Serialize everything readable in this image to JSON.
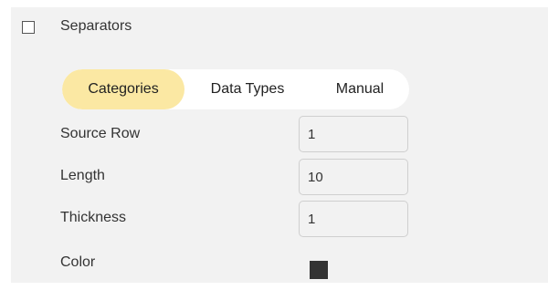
{
  "section": {
    "title": "Separators",
    "checked": false
  },
  "tabs": [
    {
      "label": "Categories",
      "active": true
    },
    {
      "label": "Data Types",
      "active": false
    },
    {
      "label": "Manual",
      "active": false
    }
  ],
  "fields": {
    "source_row": {
      "label": "Source Row",
      "value": "1"
    },
    "length": {
      "label": "Length",
      "value": "10"
    },
    "thickness": {
      "label": "Thickness",
      "value": "1"
    },
    "color": {
      "label": "Color",
      "value": "#333333"
    }
  },
  "colors": {
    "active_tab": "#fbe8a3",
    "panel_bg": "#f2f2f2"
  }
}
